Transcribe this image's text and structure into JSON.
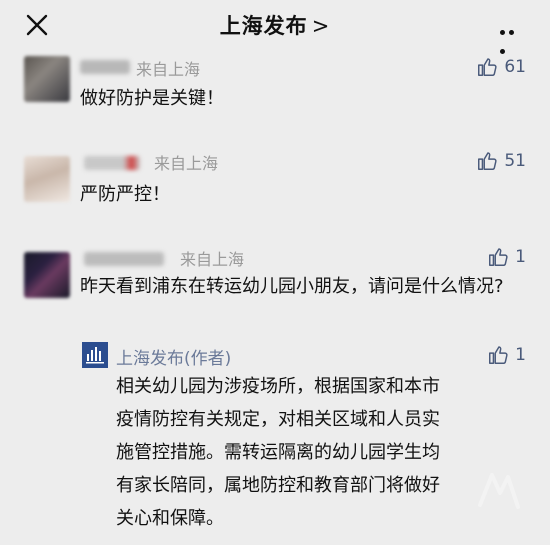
{
  "header": {
    "title": "上海发布",
    "chevron": ">"
  },
  "comments": [
    {
      "source": "来自上海",
      "likes": "61",
      "text": "做好防护是关键！"
    },
    {
      "source": "来自上海",
      "likes": "51",
      "text": "严防严控！"
    },
    {
      "source": "来自上海",
      "likes": "1",
      "text": "昨天看到浦东在转运幼儿园小朋友，请问是什么情况?",
      "reply": {
        "author": "上海发布(作者)",
        "likes": "1",
        "lines": [
          "相关幼儿园为涉疫场所，根据国家和本市",
          "疫情防控有关规定，对相关区域和人员实",
          "施管控措施。需转运隔离的幼儿园学生均",
          "有家长陪同，属地防控和教育部门将做好",
          "关心和保障。"
        ]
      }
    }
  ],
  "icons": {
    "close": "close-icon",
    "more": "more-icon",
    "like": "thumbs-up-icon"
  },
  "colors": {
    "background": "#ededed",
    "source_gray": "#9a9a9a",
    "like_blue": "#4a5a7a",
    "author_blue": "#6b7a99"
  }
}
